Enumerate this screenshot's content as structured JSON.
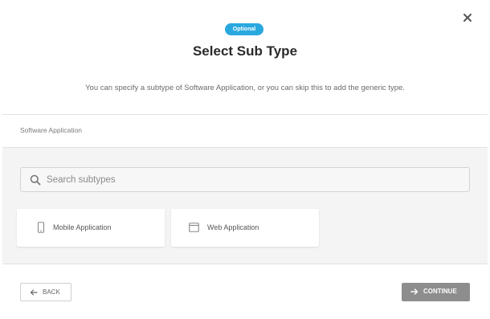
{
  "header": {
    "badge": "Optional",
    "title": "Select Sub Type",
    "subtitle": "You can specify a subtype of Software Application, or you can skip this to add the generic type."
  },
  "section": {
    "label": "Software Application"
  },
  "search": {
    "placeholder": "Search subtypes",
    "value": ""
  },
  "subtypes": [
    {
      "label": "Mobile Application",
      "icon": "mobile-phone-icon"
    },
    {
      "label": "Web Application",
      "icon": "browser-window-icon"
    }
  ],
  "footer": {
    "back_label": "BACK",
    "continue_label": "CONTINUE"
  },
  "colors": {
    "badge_bg": "#29a8df",
    "continue_bg": "#8d8d8d",
    "content_bg": "#f4f4f4"
  }
}
